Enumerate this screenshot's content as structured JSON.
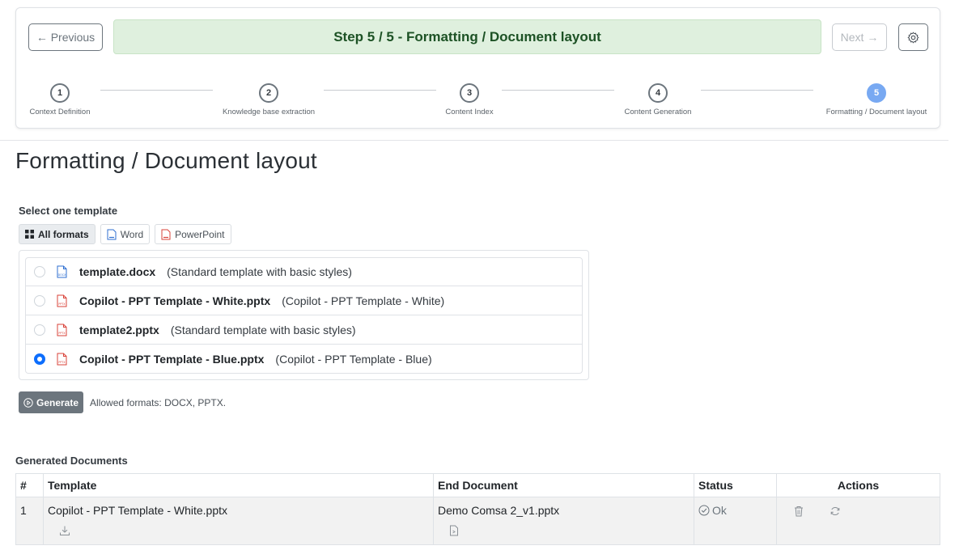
{
  "wizard": {
    "prev_label": "← Previous",
    "next_label": "Next →",
    "banner": "Step 5 / 5 - Formatting / Document layout",
    "steps": [
      {
        "num": "1",
        "label": "Context Definition"
      },
      {
        "num": "2",
        "label": "Knowledge base extraction"
      },
      {
        "num": "3",
        "label": "Content Index"
      },
      {
        "num": "4",
        "label": "Content Generation"
      },
      {
        "num": "5",
        "label": "Formatting / Document layout"
      }
    ],
    "active_color": "#78a9f2",
    "banner_bg": "#dff0de"
  },
  "page": {
    "title": "Formatting / Document layout",
    "select_label": "Select one template"
  },
  "filters": [
    {
      "label": "All formats",
      "icon": "grid-icon",
      "active": true
    },
    {
      "label": "Word",
      "icon": "docx-file-icon",
      "active": false
    },
    {
      "label": "PowerPoint",
      "icon": "pptx-file-icon",
      "active": false
    }
  ],
  "templates": [
    {
      "name": "template.docx",
      "desc": "(Standard template with basic styles)",
      "type": "docx",
      "selected": false
    },
    {
      "name": "Copilot - PPT Template - White.pptx",
      "desc": "(Copilot - PPT Template - White)",
      "type": "pptx",
      "selected": false
    },
    {
      "name": "template2.pptx",
      "desc": "(Standard template with basic styles)",
      "type": "pptx",
      "selected": false
    },
    {
      "name": "Copilot - PPT Template - Blue.pptx",
      "desc": "(Copilot - PPT Template - Blue)",
      "type": "pptx",
      "selected": true
    }
  ],
  "generate": {
    "button_label": "Generate",
    "allowed_text": "Allowed formats: DOCX, PPTX."
  },
  "generated_docs": {
    "title": "Generated Documents",
    "columns": [
      "#",
      "Template",
      "End Document",
      "Status",
      "Actions"
    ],
    "rows": [
      {
        "num": "1",
        "template": "Copilot - PPT Template - White.pptx",
        "end_document": "Demo Comsa 2_v1.pptx",
        "status": "Ok"
      }
    ]
  },
  "colors": {
    "docx": "#2f6fd1",
    "pptx": "#d9433a",
    "radio_selected": "#0d6efd"
  }
}
